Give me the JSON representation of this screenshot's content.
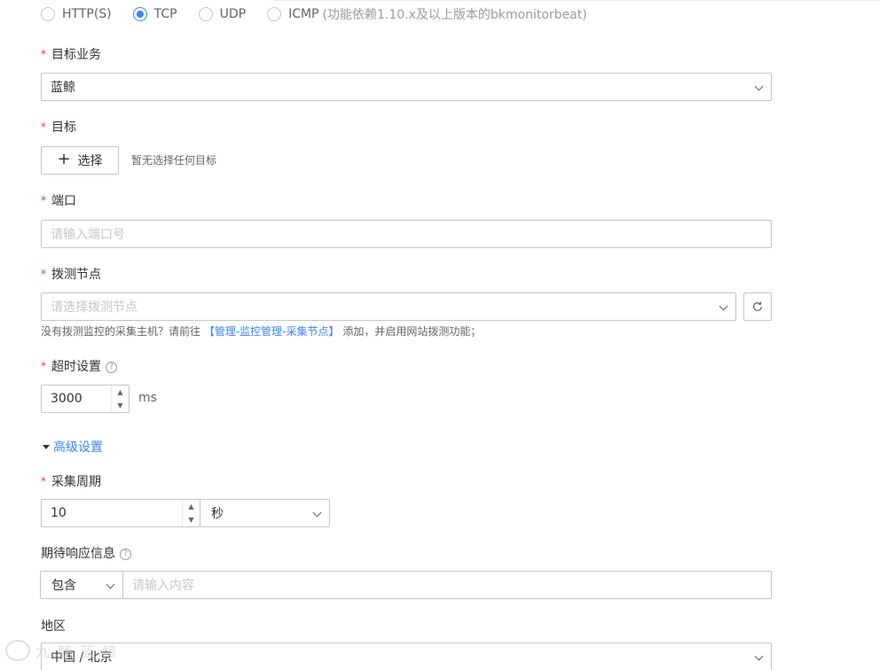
{
  "protocols": [
    {
      "label": "HTTP(S)",
      "checked": false
    },
    {
      "label": "TCP",
      "checked": true
    },
    {
      "label": "UDP",
      "checked": false
    },
    {
      "label": "ICMP",
      "checked": false,
      "hint": "(功能依赖1.10.x及以上版本的bkmonitorbeat)"
    }
  ],
  "required_mark": "*",
  "business": {
    "label": "目标业务",
    "value": "蓝鲸"
  },
  "target": {
    "label": "目标",
    "button_label": "选择",
    "plus": "+",
    "empty_hint": "暂无选择任何目标"
  },
  "port": {
    "label": "端口",
    "placeholder": "请输入端口号"
  },
  "nodes": {
    "label": "拨测节点",
    "placeholder": "请选择拨测节点",
    "hint_prefix": "没有拨测监控的采集主机？请前往",
    "hint_link": "【管理-监控管理-采集节点】",
    "hint_suffix": "添加，并启用网站拨测功能；"
  },
  "timeout": {
    "label": "超时设置",
    "value": "3000",
    "unit": "ms"
  },
  "advanced": {
    "label": "高级设置"
  },
  "period": {
    "label": "采集周期",
    "value": "10",
    "unit_value": "秒"
  },
  "response": {
    "label": "期待响应信息",
    "match_value": "包含",
    "placeholder": "请输入内容"
  },
  "region": {
    "label": "地区",
    "value": "中国 / 北京"
  },
  "icons": {
    "help": "?",
    "step_up": "▲",
    "step_down": "▼"
  },
  "watermark": {
    "text": "九 鲸 蓝 鲸"
  },
  "colors": {
    "primary": "#3a84ff",
    "required": "#ea3636",
    "border": "#c4c6cc"
  }
}
